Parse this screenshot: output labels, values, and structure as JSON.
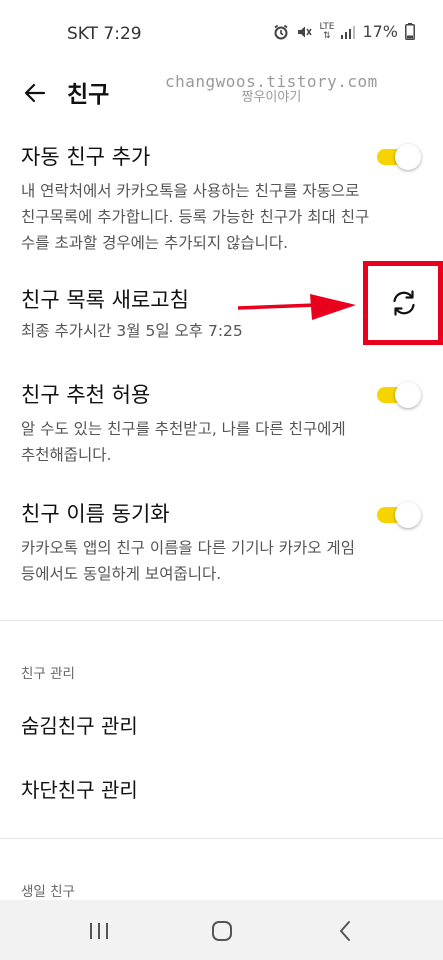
{
  "status_bar": {
    "carrier_time": "SKT 7:29",
    "lte_label": "LTE",
    "battery": "17%"
  },
  "header": {
    "title": "친구"
  },
  "watermark": {
    "line1": "changwoos.tistory.com",
    "line2": "짱우이야기"
  },
  "settings": [
    {
      "title": "자동 친구 추가",
      "description_lines": [
        "내 연락처에서 카카오톡을 사용하는 친구를 자동으로",
        "친구목록에 추가합니다. 등록 가능한 친구가 최대 친구",
        "수를 초과할 경우에는 추가되지 않습니다."
      ],
      "toggle": "on"
    },
    {
      "title": "친구 목록 새로고침",
      "description_lines": [
        "최종 추가시간 3월 5일 오후 7:25"
      ],
      "action_icon": "refresh-icon"
    },
    {
      "title": "친구 추천 허용",
      "description_lines": [
        "알 수도 있는 친구를 추천받고, 나를 다른 친구에게",
        "추천해줍니다."
      ],
      "toggle": "on"
    },
    {
      "title": "친구 이름 동기화",
      "description_lines": [
        "카카오톡 앱의 친구 이름을 다른 기기나 카카오 게임",
        "등에서도 동일하게 보여줍니다."
      ],
      "toggle": "on"
    }
  ],
  "friend_management": {
    "section_label": "친구 관리",
    "items": [
      "숨김친구 관리",
      "차단친구 관리"
    ]
  },
  "birthday_section": {
    "section_label": "생일 친구"
  },
  "colors": {
    "toggle_on": "#f5d400",
    "highlight_box": "#e8001c",
    "annotation_arrow": "#e8001c"
  },
  "nav_bar": {
    "icons": [
      "recent-apps-icon",
      "home-icon",
      "back-icon"
    ]
  }
}
